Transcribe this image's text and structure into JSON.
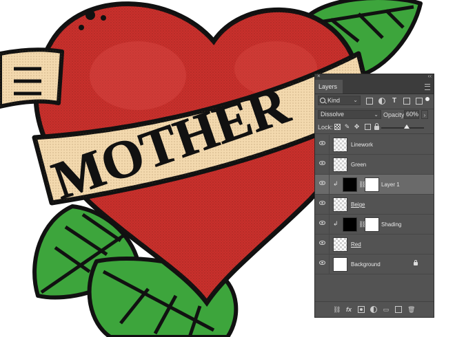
{
  "artwork": {
    "banner_text": "MOTHER",
    "colors": {
      "heart": "#c9302c",
      "leaf": "#3da53c",
      "banner": "#f3d9ae",
      "outline": "#111111"
    }
  },
  "panel": {
    "close_glyph": "×",
    "collapse_glyph": "‹‹",
    "tab_label": "Layers",
    "filter": {
      "value": "Kind",
      "icons": [
        "image-filter-icon",
        "adjustment-filter-icon",
        "type-filter-icon",
        "shape-filter-icon",
        "smart-object-filter-icon"
      ]
    },
    "blend_mode": "Dissolve",
    "opacity_label": "Opacity:",
    "opacity_value": "60%",
    "lock_label": "Lock:",
    "opacity_slider_fraction": 0.6,
    "layers": [
      {
        "name": "Linework",
        "type": "simple",
        "thumb": "checker",
        "selected": false
      },
      {
        "name": "Green",
        "type": "simple",
        "thumb": "checker",
        "selected": false
      },
      {
        "name": "Layer 1",
        "type": "masked",
        "thumb": "black",
        "mask": "white",
        "selected": true,
        "clipped": true
      },
      {
        "name": "Beige",
        "type": "simple",
        "thumb": "checker",
        "selected": false,
        "underlined": true
      },
      {
        "name": "Shading",
        "type": "masked",
        "thumb": "black",
        "mask": "white",
        "selected": false,
        "clipped": true
      },
      {
        "name": "Red",
        "type": "simple",
        "thumb": "checker",
        "selected": false,
        "underlined": true
      },
      {
        "name": "Background",
        "type": "background",
        "thumb": "white",
        "selected": false,
        "locked": true
      }
    ],
    "bottom_icons": [
      "link-layers-icon",
      "fx-icon",
      "add-mask-icon",
      "adjustment-layer-icon",
      "group-icon",
      "new-layer-icon",
      "delete-icon"
    ],
    "fx_label": "fx"
  }
}
